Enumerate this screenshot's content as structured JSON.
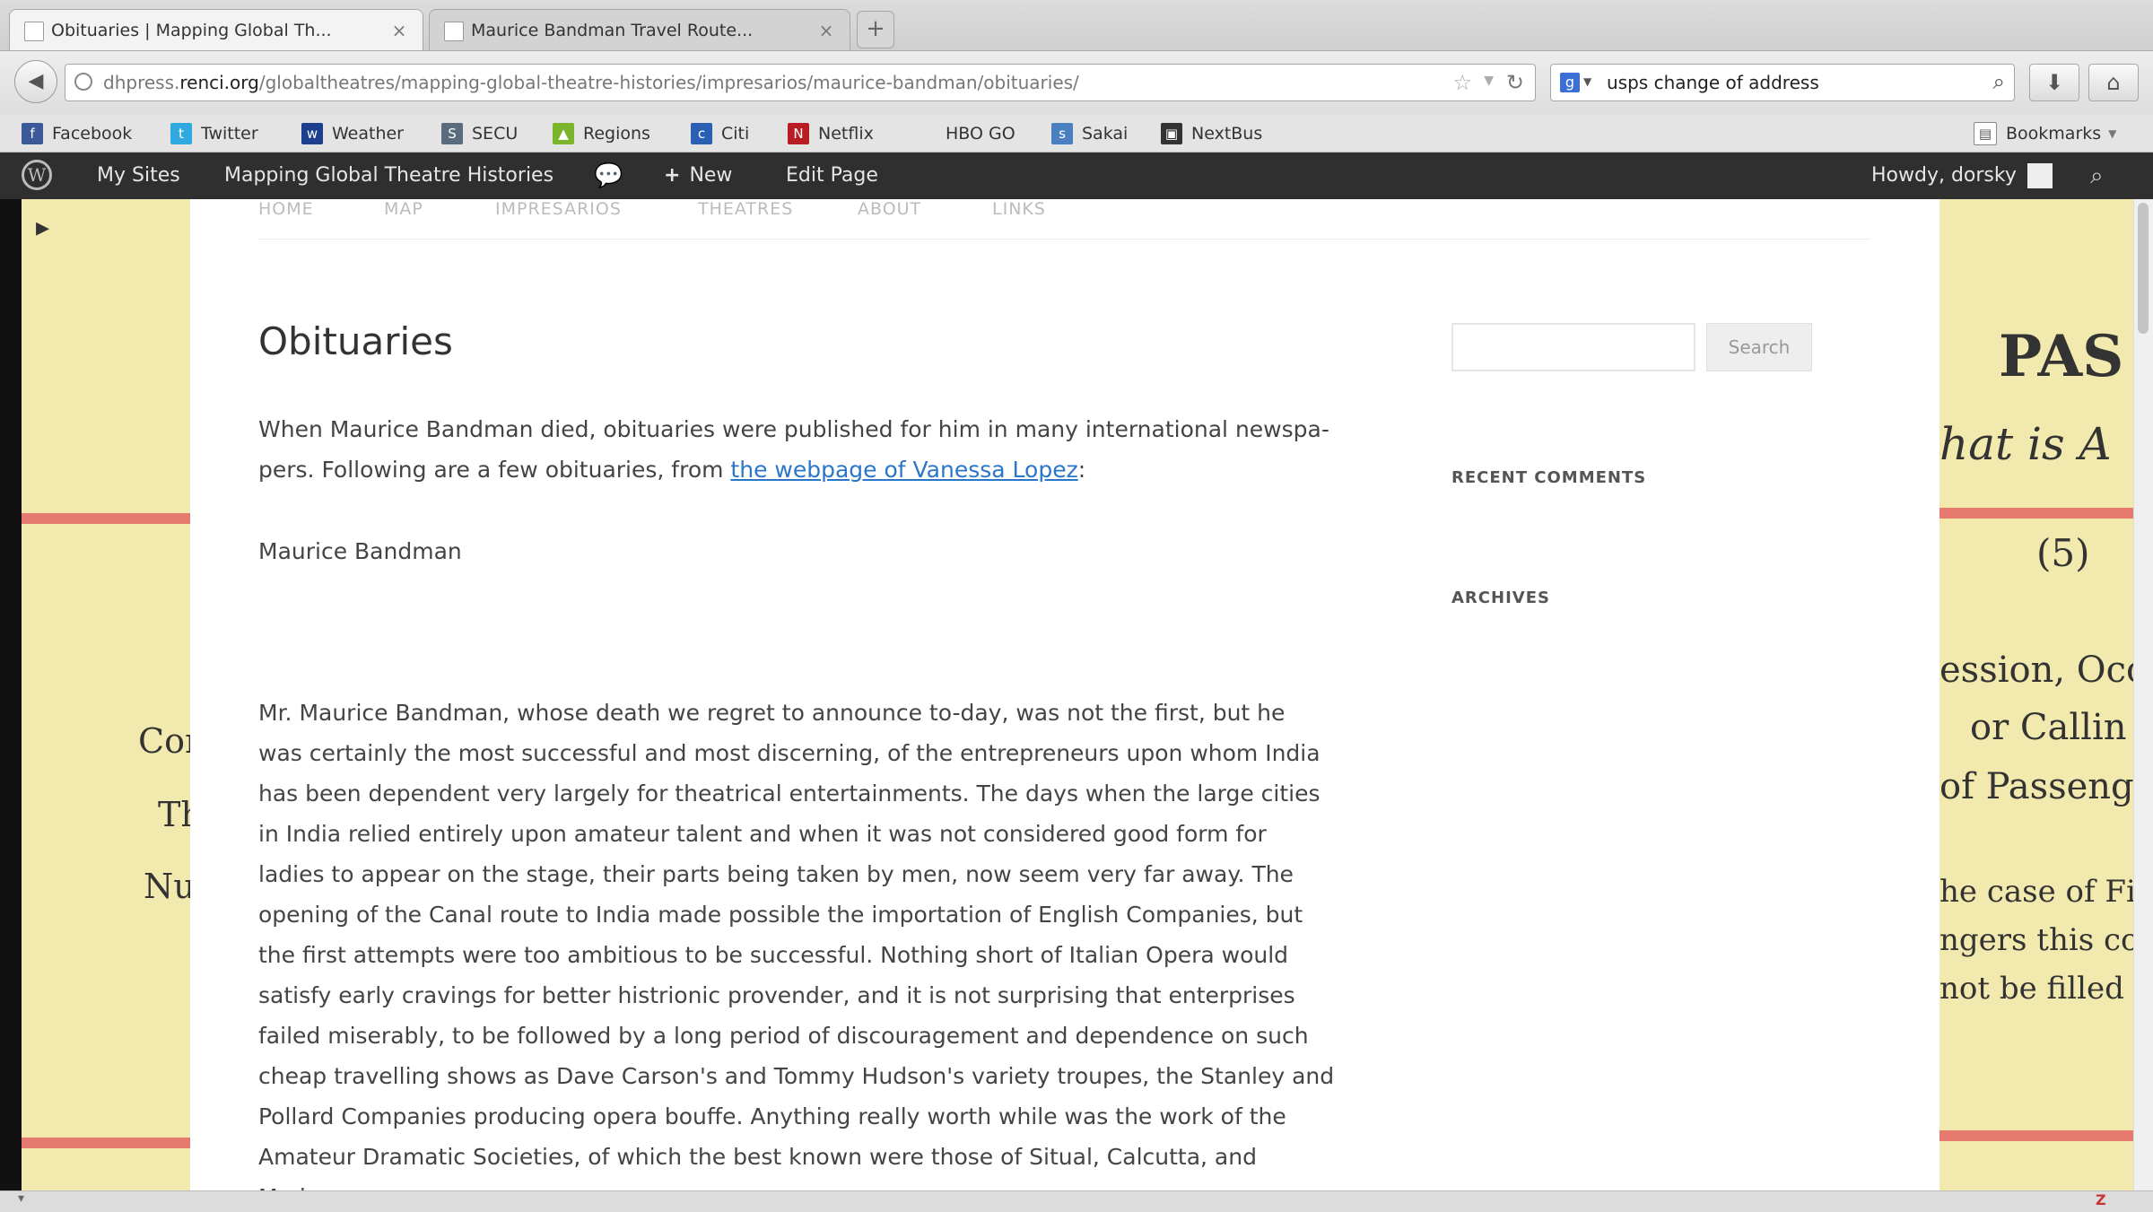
{
  "tabs": [
    {
      "title": "Obituaries | Mapping Global Th...",
      "close": "×"
    },
    {
      "title": "Maurice Bandman Travel Route...",
      "close": "×"
    }
  ],
  "new_tab_label": "+",
  "address_bar": {
    "url_prefix": "dhpress.",
    "url_domain": "renci.org",
    "url_path": "/globaltheatres/mapping-global-theatre-histories/impresarios/maurice-bandman/obituaries/"
  },
  "search_bar": {
    "value": "usps change of address"
  },
  "bookmarks": [
    {
      "label": "Facebook",
      "icon": "facebook-icon",
      "color": "#3b5998",
      "glyph": "f"
    },
    {
      "label": "Twitter",
      "icon": "twitter-icon",
      "color": "#2fa9e0",
      "glyph": "t"
    },
    {
      "label": "Weather",
      "icon": "weather-icon",
      "color": "#1d3f8f",
      "glyph": "w"
    },
    {
      "label": "SECU",
      "icon": "secu-icon",
      "color": "#5a6b7d",
      "glyph": "S"
    },
    {
      "label": "Regions",
      "icon": "regions-icon",
      "color": "#7bb52b",
      "glyph": "▲"
    },
    {
      "label": "Citi",
      "icon": "citi-icon",
      "color": "#2b5fb3",
      "glyph": "c"
    },
    {
      "label": "Netflix",
      "icon": "netflix-icon",
      "color": "#b81d24",
      "glyph": "N"
    },
    {
      "label": "HBO GO",
      "icon": "",
      "color": "",
      "glyph": ""
    },
    {
      "label": "Sakai",
      "icon": "sakai-icon",
      "color": "#4a7fc0",
      "glyph": "s"
    },
    {
      "label": "NextBus",
      "icon": "nextbus-icon",
      "color": "#333333",
      "glyph": "▣"
    }
  ],
  "bookmarks_menu": "Bookmarks",
  "admin_bar": {
    "my_sites": "My Sites",
    "site_name": "Mapping Global Theatre Histories",
    "new": "New",
    "edit_page": "Edit Page",
    "howdy": "Howdy, dorsky"
  },
  "site_menu": [
    "HOME",
    "MAP",
    "IMPRESARIOS",
    "THEATRES",
    "ABOUT",
    "LINKS"
  ],
  "page": {
    "title": "Obituaries",
    "intro_before_link": "When Maurice Bandman died, obituaries were published for him in many international newspa-pers. Following are a few obituaries, from ",
    "intro_link": "the webpage of Vanessa Lopez",
    "intro_after_link": ":",
    "subheading": "Maurice Bandman",
    "body": "Mr. Maurice Bandman, whose death we regret to announce to-day, was not the first, but he was certainly the most successful and most discerning, of the entrepreneurs upon whom India has been dependent very largely for theatrical entertainments. The days when the large cities in India relied entirely upon amateur talent and when it was not considered good form for ladies to appear on the stage, their parts being taken by men, now seem very far away. The opening of the Canal route to India made possible the importation of English Companies, but the first attempts were too ambitious to be successful. Nothing short of Italian Opera would satisfy early cravings for better histrionic provender, and it is not surprising that enterprises failed miserably, to be followed by a long period of discouragement and dependence on such cheap travelling shows as Dave Carson's and Tommy Hudson's variety troupes, the Stanley and Pollard Companies producing opera bouffe. Anything really worth while was the work of the Amateur Dramatic Societies, of which the best known were those of Situal, Calcutta, and Madras."
  },
  "sidebar": {
    "search_button": "Search",
    "recent_comments": "RECENT COMMENTS",
    "archives": "ARCHIVES"
  },
  "background_text": {
    "right": [
      "PAS",
      "hat is A",
      "(5)",
      "ession, Occ",
      "or Callin",
      "of Passeng",
      "he case of Fi",
      "ngers this col",
      "not be filled"
    ],
    "left": [
      "Con",
      "Th",
      "Nu"
    ]
  },
  "colors": {
    "admin_bar": "#2f2f2f",
    "link": "#2a76c8",
    "paper_bg": "#f1e9ad",
    "paper_line": "#e77a6f"
  }
}
